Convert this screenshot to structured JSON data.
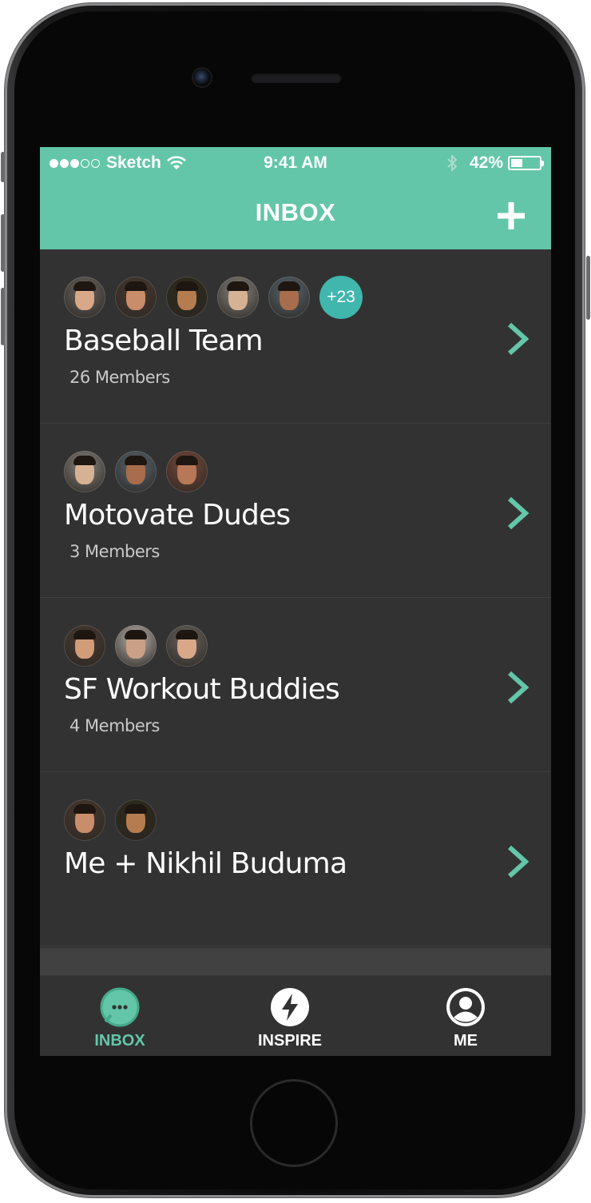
{
  "status_bar": {
    "carrier": "Sketch",
    "time": "9:41 AM",
    "battery_percent": "42%",
    "battery_level": 0.42,
    "signal_bars_filled": 3,
    "signal_bars_total": 5
  },
  "header": {
    "title": "INBOX",
    "add_icon": "plus-icon",
    "background_color": "#63c6a8"
  },
  "groups": [
    {
      "name": "Baseball Team",
      "members": "26 Members",
      "avatars": 5,
      "more_badge": "+23"
    },
    {
      "name": "Motovate Dudes",
      "members": "3 Members",
      "avatars": 3,
      "more_badge": ""
    },
    {
      "name": "SF Workout Buddies",
      "members": "4 Members",
      "avatars": 3,
      "more_badge": ""
    },
    {
      "name": "Me + Nikhil Buduma",
      "members": "",
      "avatars": 2,
      "more_badge": ""
    }
  ],
  "tabs": [
    {
      "label": "INBOX",
      "icon": "chat-bubble-icon",
      "active": true
    },
    {
      "label": "INSPIRE",
      "icon": "lightning-icon",
      "active": false
    },
    {
      "label": "ME",
      "icon": "user-icon",
      "active": false
    }
  ],
  "colors": {
    "accent": "#63c6a8",
    "badge": "#40b6ad",
    "background": "#323232",
    "active_tab": "#63c6a8",
    "inactive_tab": "#ffffff"
  }
}
